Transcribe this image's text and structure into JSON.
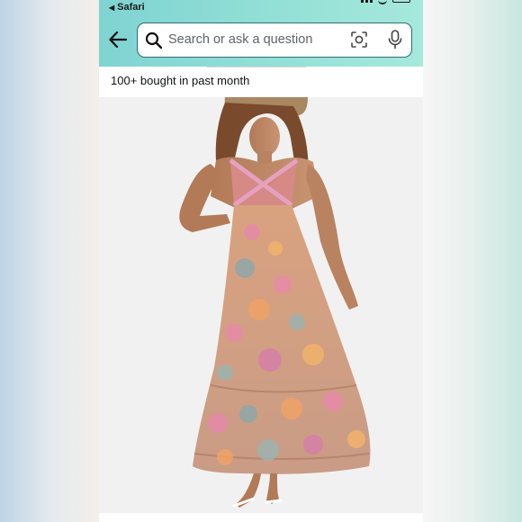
{
  "status_bar": {
    "back_app": "Safari"
  },
  "search": {
    "placeholder": "Search or ask a question"
  },
  "product": {
    "bought_text": "100+ bought in past month"
  },
  "icons": {
    "back": "arrow-left-icon",
    "search": "search-icon",
    "lens": "camera-lens-icon",
    "mic": "microphone-icon"
  },
  "colors": {
    "header": "#93e0d6",
    "search_border": "#2a6f74",
    "background": "#ffffff"
  }
}
